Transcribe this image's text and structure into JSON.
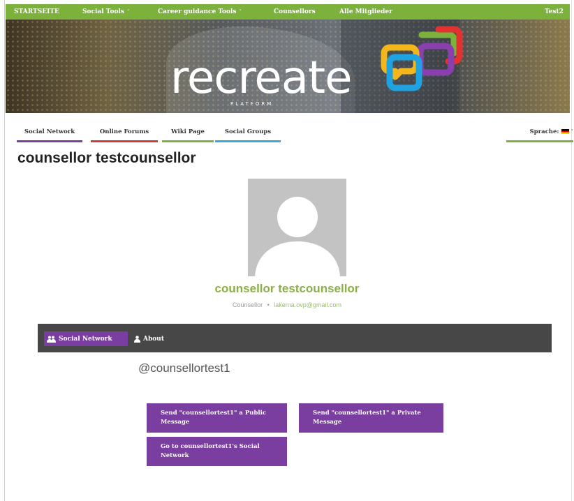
{
  "topnav": {
    "items": [
      {
        "label": "STARTSEITE",
        "dropdown": false
      },
      {
        "label": "Social Tools",
        "dropdown": true
      },
      {
        "label": "Career guidance Tools",
        "dropdown": true
      },
      {
        "label": "Counsellors",
        "dropdown": false
      },
      {
        "label": "Alle Mitglieder",
        "dropdown": false
      }
    ],
    "user": "Test2",
    "caret": "˅"
  },
  "banner": {
    "logo_text": "recreate",
    "logo_sub": "PLATFORM"
  },
  "subnav": {
    "tabs": [
      {
        "label": "Social Network",
        "color": "#7a3ea0"
      },
      {
        "label": "Online Forums",
        "color": "#d23b3b"
      },
      {
        "label": "Wiki Page",
        "color": "#7cb23c"
      },
      {
        "label": "Social Groups",
        "color": "#3aa7d8"
      }
    ],
    "language_label": "Sprache:",
    "language_caret": "˅"
  },
  "profile": {
    "page_title": "counsellor testcounsellor",
    "display_name": "counsellor testcounsellor",
    "role": "Counsellor",
    "separator": "•",
    "email": "lakerna.ovp@gmail.com",
    "handle": "@counsellortest1"
  },
  "profile_tabs": [
    {
      "label": "Social Network",
      "active": true,
      "icon": "users-icon"
    },
    {
      "label": "About",
      "active": false,
      "icon": "user-icon"
    }
  ],
  "actions": {
    "public_message": "Send \"counsellortest1\" a Public Message",
    "private_message": "Send \"counsellortest1\" a Private Message",
    "social_network": "Go to counsellortest1's Social Network"
  },
  "colors": {
    "brand_green": "#7cb23c",
    "accent_purple": "#7a3ea0",
    "dark_bar": "#474747"
  }
}
